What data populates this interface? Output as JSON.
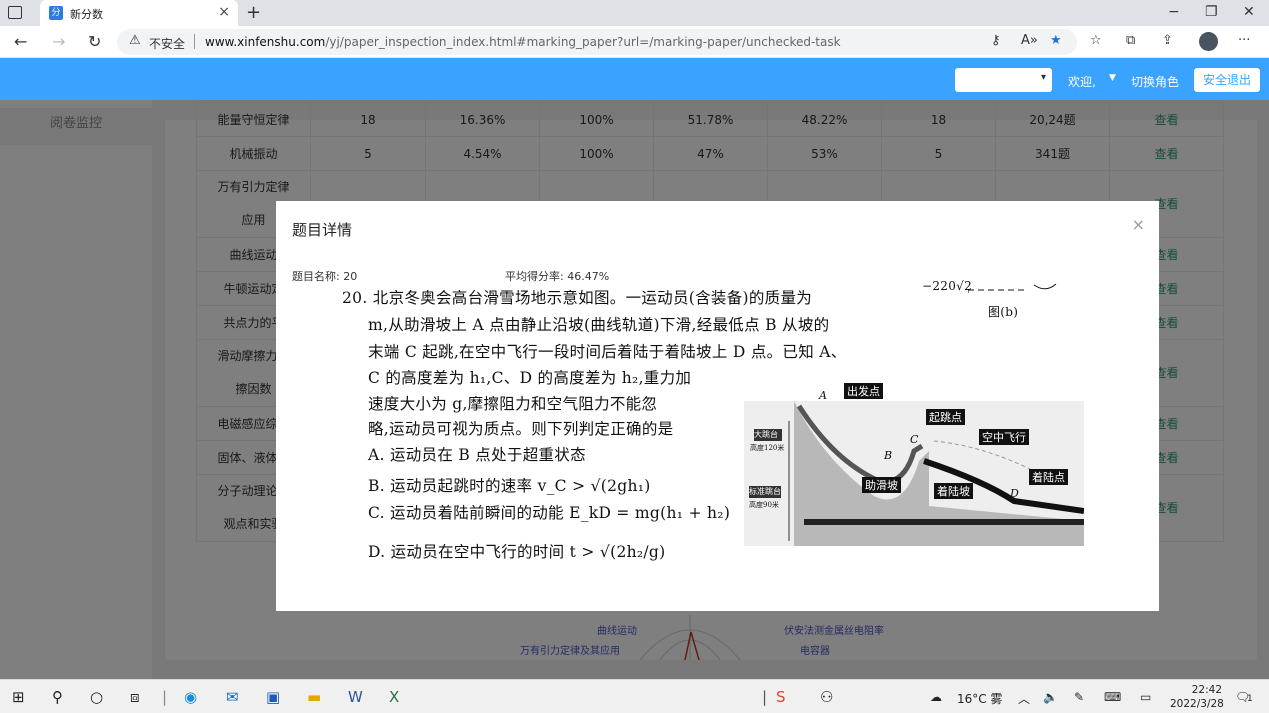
{
  "browser": {
    "tab_title": "新分数",
    "tab_close": "×",
    "new_tab": "+",
    "window_controls": {
      "minimize": "−",
      "restore": "❐",
      "close": "✕"
    },
    "nav": {
      "back": "←",
      "forward": "→",
      "reload": "↻"
    },
    "security_label": "不安全",
    "url_host": "www.xinfenshu.com",
    "url_path": "/yj/paper_inspection_index.html#marking_paper?url=/marking-paper/unchecked-task",
    "icons": [
      "key-icon",
      "read-aloud-icon",
      "favorite-star-icon",
      "favorites-icon",
      "collections-icon",
      "share-icon",
      "profile-avatar",
      "more-icon"
    ]
  },
  "header": {
    "role_select_value": "",
    "welcome": "欢迎,",
    "switch_role": "切换角色",
    "logout": "安全退出",
    "accent_color": "#3aa3ff"
  },
  "sidebar": {
    "items": [
      {
        "label": "阅卷监控"
      }
    ]
  },
  "stats_table": {
    "rows": [
      [
        "能量守恒定律",
        "18",
        "16.36%",
        "100%",
        "51.78%",
        "48.22%",
        "18",
        "20,24题",
        "查看"
      ],
      [
        "机械振动",
        "5",
        "4.54%",
        "100%",
        "47%",
        "53%",
        "5",
        "341题",
        "查看"
      ],
      [
        "万有引力定律\n应用",
        "",
        "",
        "",
        "",
        "",
        "",
        "",
        "查看"
      ],
      [
        "曲线运动",
        "",
        "",
        "",
        "",
        "",
        "",
        "",
        "查看"
      ],
      [
        "牛顿运动定",
        "",
        "",
        "",
        "",
        "",
        "",
        "",
        "查看"
      ],
      [
        "共点力的平",
        "",
        "",
        "",
        "",
        "",
        "",
        "",
        "查看"
      ],
      [
        "滑动摩擦力与\n擦因数",
        "",
        "",
        "",
        "",
        "",
        "",
        "",
        "查看"
      ],
      [
        "电磁感应综合",
        "",
        "",
        "",
        "",
        "",
        "",
        "",
        "查看"
      ],
      [
        "固体、液体和",
        "",
        "",
        "",
        "",
        "",
        "",
        "",
        "查看"
      ],
      [
        "分子动理论的\n观点和实验",
        "",
        "",
        "",
        "",
        "",
        "",
        "",
        "查看"
      ]
    ]
  },
  "radar_labels": [
    "曲线运动",
    "万有引力定律及其应用",
    "伏安法测金属丝电阻率",
    "电容器"
  ],
  "modal": {
    "title": "题目详情",
    "close": "×",
    "question_name": "题目名称: 20",
    "avg_score": "平均得分率: 46.47%",
    "question_lines": [
      "20. 北京冬奥会高台滑雪场地示意如图。一运动员(含装备)的质量为",
      "m,从助滑坡上 A 点由静止沿坡(曲线轨道)下滑,经最低点 B 从坡的",
      "末端 C 起跳,在空中飞行一段时间后着陆于着陆坡上 D 点。已知 A、",
      "C 的高度差为 h₁,C、D 的高度差为 h₂,重力加",
      "速度大小为 g,摩擦阻力和空气阻力不能忽",
      "略,运动员可视为质点。则下列判定正确的是",
      "A. 运动员在 B 点处于超重状态",
      "B. 运动员起跳时的速率 v_C > √(2gh₁)",
      "C. 运动员着陆前瞬间的动能 E_kD = mg(h₁ + h₂)",
      "D. 运动员在空中飞行的时间 t > √(2h₂/g)"
    ],
    "fig_b_label": "图(b)",
    "fig_b_axis": "−220√2",
    "figure_labels": [
      "出发点",
      "起跳点",
      "空中飞行",
      "着陆点",
      "助滑坡",
      "着陆坡",
      "大跳台",
      "高度120米",
      "标准跳台",
      "高度90米",
      "A",
      "B",
      "C",
      "D"
    ]
  },
  "taskbar": {
    "weather": "16°C 雾",
    "time": "22:42",
    "date": "2022/3/28",
    "notification_count": "1"
  }
}
